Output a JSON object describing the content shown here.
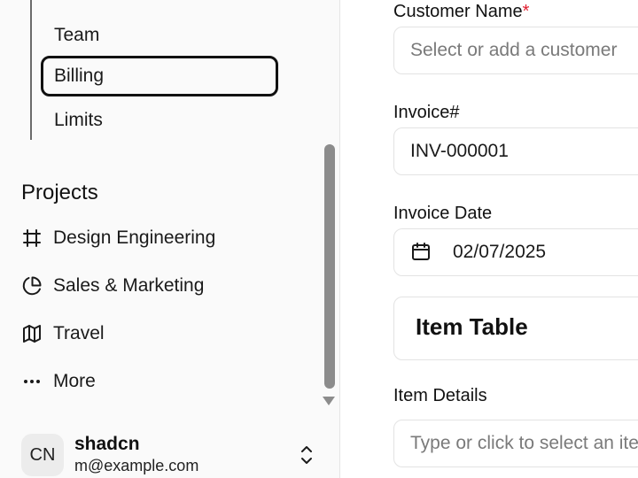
{
  "sidebar": {
    "sub_items": [
      {
        "label": "Team"
      },
      {
        "label": "Billing",
        "active": true
      },
      {
        "label": "Limits"
      }
    ],
    "projects_title": "Projects",
    "projects": [
      {
        "label": "Design Engineering",
        "icon": "hash-frame-icon"
      },
      {
        "label": "Sales & Marketing",
        "icon": "pie-chart-icon"
      },
      {
        "label": "Travel",
        "icon": "map-icon"
      },
      {
        "label": "More",
        "icon": "more-horizontal-icon"
      }
    ],
    "user": {
      "initials": "CN",
      "name": "shadcn",
      "email": "m@example.com",
      "icon": "chevrons-up-down-icon"
    }
  },
  "form": {
    "customer": {
      "label": "Customer Name",
      "required_mark": "*",
      "placeholder": "Select or add a customer"
    },
    "invoice_number": {
      "label": "Invoice#",
      "value": "INV-000001"
    },
    "invoice_date": {
      "label": "Invoice Date",
      "value": "02/07/2025",
      "icon": "calendar-icon"
    },
    "item_table": {
      "title": "Item Table"
    },
    "item_details": {
      "label": "Item Details",
      "placeholder": "Type or click to select an item"
    }
  },
  "colors": {
    "required": "#e11d2e",
    "scrollbar": "#8c8c8c",
    "active_border": "#111111"
  }
}
